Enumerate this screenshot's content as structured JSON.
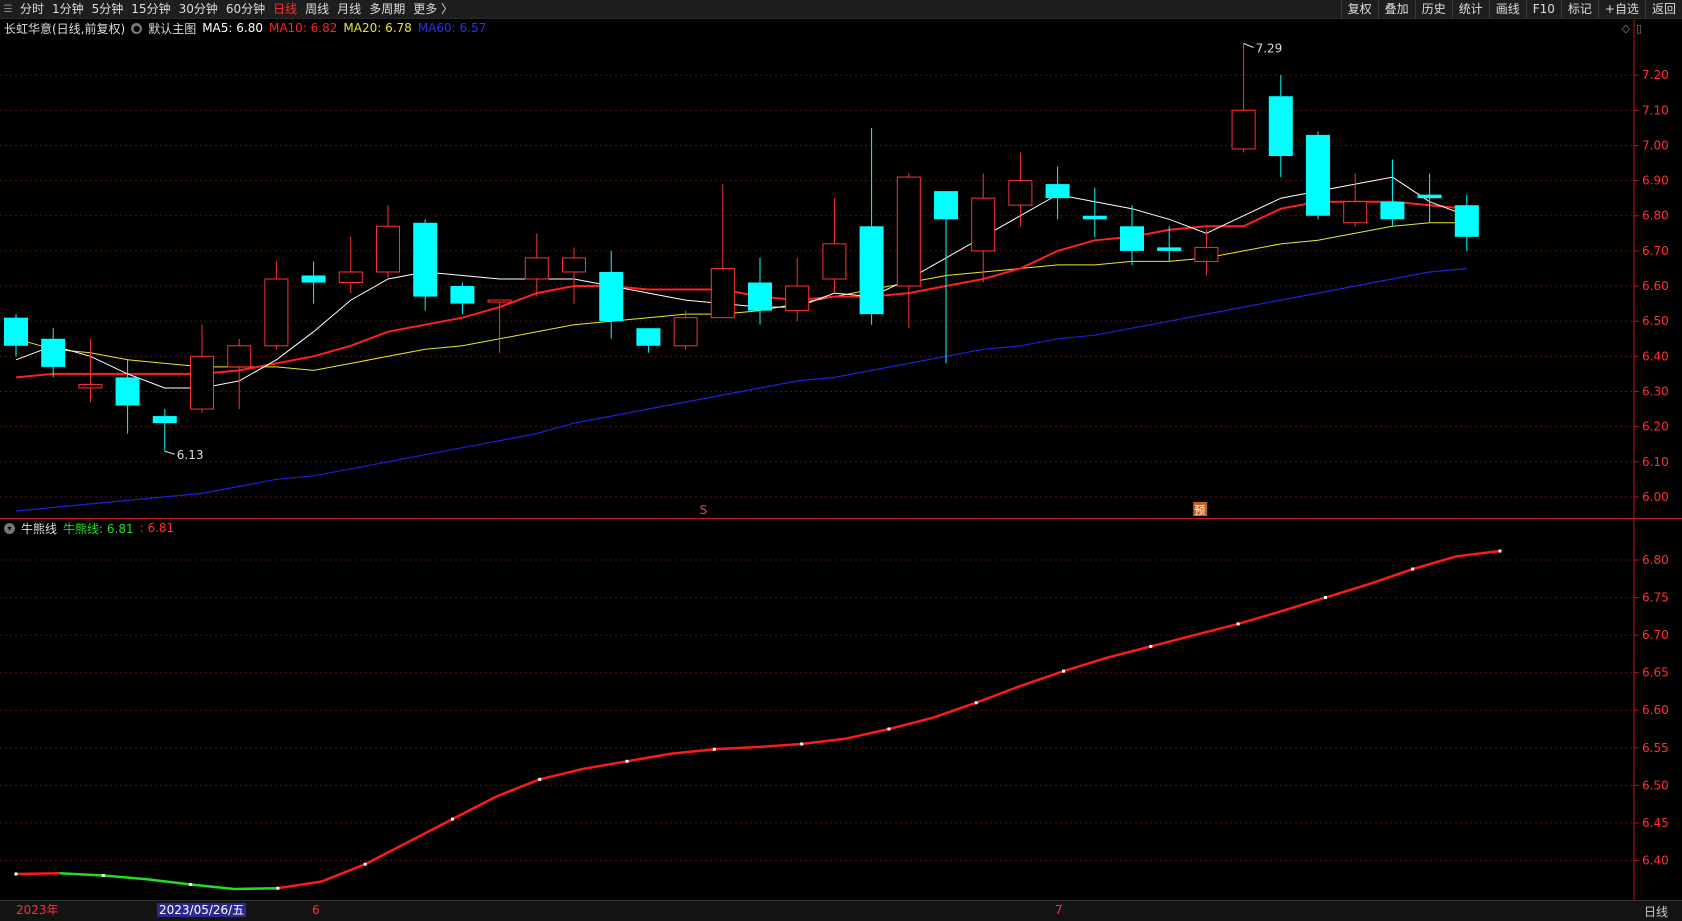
{
  "toolbar": {
    "periods": [
      "分时",
      "1分钟",
      "5分钟",
      "15分钟",
      "30分钟",
      "60分钟",
      "日线",
      "周线",
      "月线",
      "多周期",
      "更多 〉"
    ],
    "active": "日线",
    "right": [
      "复权",
      "叠加",
      "历史",
      "统计",
      "画线",
      "F10",
      "标记",
      "+自选",
      "返回"
    ]
  },
  "main_legend": {
    "title": "长虹华意(日线,前复权)",
    "template": "默认主图",
    "ma5": "MA5: 6.80",
    "ma10": "MA10: 6.82",
    "ma20": "MA20: 6.78",
    "ma60": "MA60: 6.57"
  },
  "sub_legend": {
    "title": "牛熊线",
    "line_label": "牛熊线: 6.81",
    "value": ": 6.81"
  },
  "colors": {
    "up": "#ff3232",
    "down": "#00ffff",
    "ma5": "#ffffff",
    "ma10": "#ff2020",
    "ma20": "#e8e82a",
    "ma60": "#2020d8",
    "bull": "#ff1a1a",
    "bear": "#22dd22"
  },
  "markers": {
    "high": "7.29",
    "low": "6.13",
    "s_flag": "S",
    "yu_flag": "预"
  },
  "status_bar": {
    "year": "2023年",
    "cursor_date": "2023/05/26/五",
    "month6": "6",
    "month7": "7",
    "period": "日线"
  },
  "chart_data": [
    {
      "type": "candlestick",
      "title": "长虹华意(日线,前复权)",
      "ylim": [
        5.94,
        7.3
      ],
      "yticks": [
        6.0,
        6.1,
        6.2,
        6.3,
        6.4,
        6.5,
        6.6,
        6.7,
        6.8,
        6.9,
        7.0,
        7.1,
        7.2
      ],
      "candles": [
        {
          "o": 6.51,
          "h": 6.52,
          "l": 6.4,
          "c": 6.43
        },
        {
          "o": 6.45,
          "h": 6.48,
          "l": 6.34,
          "c": 6.37
        },
        {
          "o": 6.31,
          "h": 6.45,
          "l": 6.27,
          "c": 6.32
        },
        {
          "o": 6.34,
          "h": 6.39,
          "l": 6.18,
          "c": 6.26
        },
        {
          "o": 6.23,
          "h": 6.25,
          "l": 6.13,
          "c": 6.21
        },
        {
          "o": 6.25,
          "h": 6.49,
          "l": 6.24,
          "c": 6.4
        },
        {
          "o": 6.37,
          "h": 6.45,
          "l": 6.25,
          "c": 6.43
        },
        {
          "o": 6.43,
          "h": 6.67,
          "l": 6.42,
          "c": 6.62
        },
        {
          "o": 6.63,
          "h": 6.67,
          "l": 6.55,
          "c": 6.61
        },
        {
          "o": 6.61,
          "h": 6.74,
          "l": 6.58,
          "c": 6.64
        },
        {
          "o": 6.64,
          "h": 6.83,
          "l": 6.62,
          "c": 6.77
        },
        {
          "o": 6.78,
          "h": 6.79,
          "l": 6.53,
          "c": 6.57
        },
        {
          "o": 6.6,
          "h": 6.61,
          "l": 6.52,
          "c": 6.55
        },
        {
          "o": 6.56,
          "h": 6.56,
          "l": 6.41,
          "c": 6.56
        },
        {
          "o": 6.62,
          "h": 6.75,
          "l": 6.57,
          "c": 6.68
        },
        {
          "o": 6.64,
          "h": 6.71,
          "l": 6.55,
          "c": 6.68
        },
        {
          "o": 6.64,
          "h": 6.7,
          "l": 6.45,
          "c": 6.5
        },
        {
          "o": 6.48,
          "h": 6.48,
          "l": 6.41,
          "c": 6.43
        },
        {
          "o": 6.43,
          "h": 6.53,
          "l": 6.42,
          "c": 6.51
        },
        {
          "o": 6.51,
          "h": 6.89,
          "l": 6.51,
          "c": 6.65
        },
        {
          "o": 6.61,
          "h": 6.68,
          "l": 6.49,
          "c": 6.53
        },
        {
          "o": 6.53,
          "h": 6.68,
          "l": 6.5,
          "c": 6.6
        },
        {
          "o": 6.62,
          "h": 6.85,
          "l": 6.58,
          "c": 6.72
        },
        {
          "o": 6.77,
          "h": 7.05,
          "l": 6.49,
          "c": 6.52
        },
        {
          "o": 6.6,
          "h": 6.92,
          "l": 6.48,
          "c": 6.91
        },
        {
          "o": 6.87,
          "h": 6.87,
          "l": 6.38,
          "c": 6.79
        },
        {
          "o": 6.7,
          "h": 6.92,
          "l": 6.61,
          "c": 6.85
        },
        {
          "o": 6.83,
          "h": 6.98,
          "l": 6.77,
          "c": 6.9
        },
        {
          "o": 6.89,
          "h": 6.94,
          "l": 6.79,
          "c": 6.85
        },
        {
          "o": 6.8,
          "h": 6.88,
          "l": 6.74,
          "c": 6.79
        },
        {
          "o": 6.77,
          "h": 6.83,
          "l": 6.66,
          "c": 6.7
        },
        {
          "o": 6.71,
          "h": 6.77,
          "l": 6.67,
          "c": 6.7
        },
        {
          "o": 6.67,
          "h": 6.76,
          "l": 6.63,
          "c": 6.71
        },
        {
          "o": 6.99,
          "h": 7.29,
          "l": 6.98,
          "c": 7.1
        },
        {
          "o": 7.14,
          "h": 7.2,
          "l": 6.91,
          "c": 6.97
        },
        {
          "o": 7.03,
          "h": 7.04,
          "l": 6.79,
          "c": 6.8
        },
        {
          "o": 6.78,
          "h": 6.92,
          "l": 6.77,
          "c": 6.84
        },
        {
          "o": 6.84,
          "h": 6.96,
          "l": 6.77,
          "c": 6.79
        },
        {
          "o": 6.86,
          "h": 6.92,
          "l": 6.78,
          "c": 6.85
        },
        {
          "o": 6.83,
          "h": 6.86,
          "l": 6.7,
          "c": 6.74
        }
      ],
      "ma5": [
        6.39,
        6.43,
        6.4,
        6.35,
        6.31,
        6.31,
        6.33,
        6.39,
        6.47,
        6.56,
        6.62,
        6.64,
        6.63,
        6.62,
        6.62,
        6.62,
        6.6,
        6.58,
        6.56,
        6.55,
        6.54,
        6.54,
        6.58,
        6.57,
        6.62,
        6.68,
        6.74,
        6.8,
        6.86,
        6.84,
        6.82,
        6.79,
        6.75,
        6.8,
        6.85,
        6.87,
        6.89,
        6.91,
        6.84,
        6.8
      ],
      "ma10": [
        6.34,
        6.35,
        6.35,
        6.35,
        6.35,
        6.35,
        6.36,
        6.38,
        6.4,
        6.43,
        6.47,
        6.49,
        6.51,
        6.54,
        6.58,
        6.6,
        6.6,
        6.59,
        6.59,
        6.59,
        6.57,
        6.56,
        6.57,
        6.57,
        6.58,
        6.6,
        6.62,
        6.65,
        6.7,
        6.73,
        6.74,
        6.76,
        6.77,
        6.77,
        6.82,
        6.84,
        6.84,
        6.84,
        6.83,
        6.82
      ],
      "ma20": [
        6.45,
        6.42,
        6.41,
        6.39,
        6.38,
        6.37,
        6.37,
        6.37,
        6.36,
        6.38,
        6.4,
        6.42,
        6.43,
        6.45,
        6.47,
        6.49,
        6.5,
        6.51,
        6.52,
        6.52,
        6.53,
        6.55,
        6.57,
        6.59,
        6.61,
        6.63,
        6.64,
        6.65,
        6.66,
        6.66,
        6.67,
        6.67,
        6.68,
        6.7,
        6.72,
        6.73,
        6.75,
        6.77,
        6.78,
        6.78
      ],
      "ma60": [
        5.96,
        5.97,
        5.98,
        5.99,
        6.0,
        6.01,
        6.03,
        6.05,
        6.06,
        6.08,
        6.1,
        6.12,
        6.14,
        6.16,
        6.18,
        6.21,
        6.23,
        6.25,
        6.27,
        6.29,
        6.31,
        6.33,
        6.34,
        6.36,
        6.38,
        6.4,
        6.42,
        6.43,
        6.45,
        6.46,
        6.48,
        6.5,
        6.52,
        6.54,
        6.56,
        6.58,
        6.6,
        6.62,
        6.64,
        6.65
      ]
    },
    {
      "type": "line",
      "title": "牛熊线",
      "ylim": [
        6.35,
        6.84
      ],
      "yticks": [
        6.4,
        6.45,
        6.5,
        6.55,
        6.6,
        6.65,
        6.7,
        6.75,
        6.8
      ],
      "series": [
        {
          "name": "牛熊线",
          "values": [
            6.382,
            6.383,
            6.38,
            6.375,
            6.368,
            6.362,
            6.363,
            6.372,
            6.395,
            6.425,
            6.455,
            6.485,
            6.508,
            6.522,
            6.532,
            6.542,
            6.548,
            6.551,
            6.555,
            6.562,
            6.575,
            6.59,
            6.61,
            6.632,
            6.652,
            6.67,
            6.685,
            6.7,
            6.715,
            6.732,
            6.75,
            6.768,
            6.788,
            6.805,
            6.812
          ]
        }
      ],
      "bear_segment_end_index": 6
    }
  ]
}
